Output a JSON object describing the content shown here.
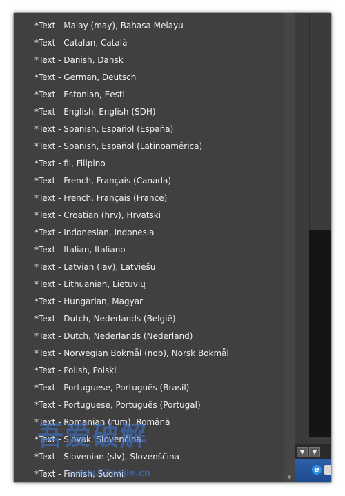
{
  "language_menu": {
    "items": [
      "*Text - Malay (may), Bahasa Melayu",
      "*Text - Catalan, Català",
      "*Text - Danish, Dansk",
      "*Text - German, Deutsch",
      "*Text - Estonian, Eesti",
      "*Text - English, English (SDH)",
      "*Text - Spanish, Español (España)",
      "*Text - Spanish, Español (Latinoamérica)",
      "*Text - fil, Filipino",
      "*Text - French, Français (Canada)",
      "*Text - French, Français (France)",
      "*Text - Croatian (hrv), Hrvatski",
      "*Text - Indonesian, Indonesia",
      "*Text - Italian, Italiano",
      "*Text - Latvian (lav), Latviešu",
      "*Text - Lithuanian, Lietuvių",
      "*Text - Hungarian, Magyar",
      "*Text - Dutch, Nederlands (België)",
      "*Text - Dutch, Nederlands (Nederland)",
      "*Text - Norwegian Bokmål (nob), Norsk Bokmål",
      "*Text - Polish, Polski",
      "*Text - Portuguese, Português (Brasil)",
      "*Text - Portuguese, Português (Portugal)",
      "*Text - Romanian (rum), Română",
      "*Text - Slovak, Slovenčina",
      "*Text - Slovenian (slv), Slovenščina",
      "*Text - Finnish, Suomi"
    ]
  },
  "background_app": {
    "toolbar_buttons": [
      "▼",
      "▼"
    ]
  },
  "watermark": {
    "chinese_text": "吾爱破解",
    "url_text": "www.52pojie.cn"
  },
  "colors": {
    "menu_background": "#404040",
    "menu_text": "#f0f0f0",
    "watermark": "#3c78dc"
  }
}
